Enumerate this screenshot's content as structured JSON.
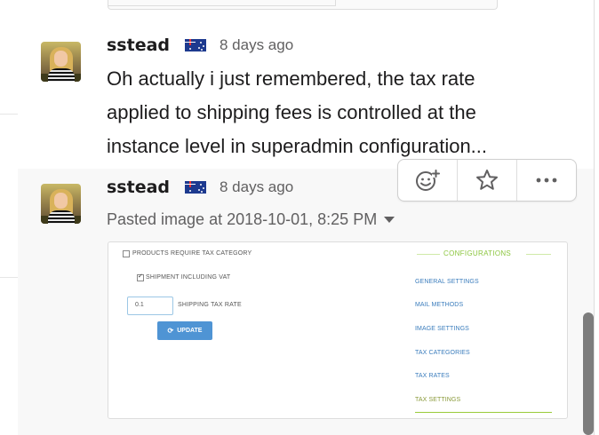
{
  "messages": [
    {
      "sender": "sstead",
      "flag": "australia-flag-icon",
      "time": "8 days ago",
      "text_lines": [
        "Oh actually i just remembered, the tax rate",
        "applied to shipping fees is controlled at the",
        "instance level in superadmin configuration..."
      ]
    },
    {
      "sender": "sstead",
      "flag": "australia-flag-icon",
      "time": "8 days ago",
      "attachment_label": "Pasted image at 2018-10-01, 8:25 PM"
    }
  ],
  "message_actions": [
    "add-reaction-icon",
    "star-icon",
    "more-actions-icon"
  ],
  "pasted_image": {
    "checkbox_products": "PRODUCTS REQUIRE TAX CATEGORY",
    "checkbox_shipment": "SHIPMENT INCLUDING VAT",
    "shipping_rate_value": "0.1",
    "shipping_rate_label": "SHIPPING TAX RATE",
    "update_label": "UPDATE",
    "configurations_title": "CONFIGURATIONS",
    "links": [
      "GENERAL SETTINGS",
      "MAIL METHODS",
      "IMAGE SETTINGS",
      "TAX CATEGORIES",
      "TAX RATES",
      "TAX SETTINGS"
    ],
    "active_link": "TAX SETTINGS"
  },
  "colors": {
    "link_blue": "#3b7dbd",
    "config_green": "#8cc63f",
    "update_button": "#4f94d4"
  }
}
